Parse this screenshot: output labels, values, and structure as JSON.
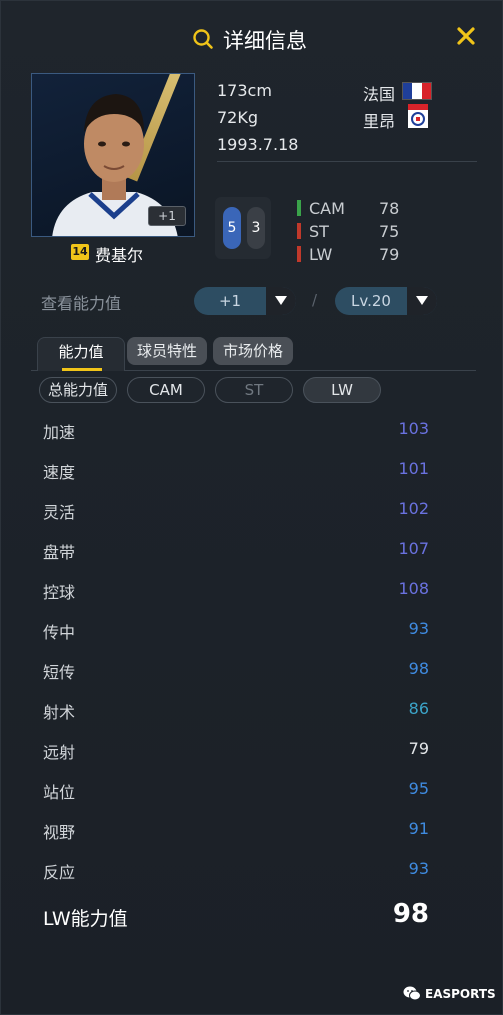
{
  "header": {
    "title": "详细信息"
  },
  "player": {
    "name": "费基尔",
    "season_badge": "14",
    "upgrade_badge": "+1",
    "height": "173cm",
    "weight": "72Kg",
    "birthdate": "1993.7.18",
    "nation": "法国",
    "club": "里昂",
    "rank_a": "5",
    "rank_b": "3"
  },
  "positions": [
    {
      "label": "CAM",
      "value": "78",
      "color": "#3aa34a"
    },
    {
      "label": "ST",
      "value": "75",
      "color": "#c0392b"
    },
    {
      "label": "LW",
      "value": "79",
      "color": "#c0392b"
    }
  ],
  "controls": {
    "check_label": "查看能力值",
    "upgrade_value": "+1",
    "slash": "/",
    "level_value": "Lv.20"
  },
  "tabs": [
    "能力值",
    "球员特性",
    "市场价格"
  ],
  "filters": [
    "总能力值",
    "CAM",
    "ST",
    "LW"
  ],
  "stats": [
    {
      "name": "加速",
      "value": "103",
      "color": "#6a72e0"
    },
    {
      "name": "速度",
      "value": "101",
      "color": "#6a72e0"
    },
    {
      "name": "灵活",
      "value": "102",
      "color": "#6a72e0"
    },
    {
      "name": "盘带",
      "value": "107",
      "color": "#6a72e0"
    },
    {
      "name": "控球",
      "value": "108",
      "color": "#6a72e0"
    },
    {
      "name": "传中",
      "value": "93",
      "color": "#3f8be0"
    },
    {
      "name": "短传",
      "value": "98",
      "color": "#3f8be0"
    },
    {
      "name": "射术",
      "value": "86",
      "color": "#3ba4c8"
    },
    {
      "name": "远射",
      "value": "79",
      "color": "#e3e6e9"
    },
    {
      "name": "站位",
      "value": "95",
      "color": "#3f8be0"
    },
    {
      "name": "视野",
      "value": "91",
      "color": "#3f8be0"
    },
    {
      "name": "反应",
      "value": "93",
      "color": "#3f8be0"
    }
  ],
  "total": {
    "label": "LW能力值",
    "value": "98"
  },
  "watermark": {
    "text": "EASPORTS"
  },
  "colors": {
    "accent": "#f0c419",
    "flag_blue": "#1f3f9a",
    "flag_white": "#ffffff",
    "flag_red": "#d8232a"
  }
}
